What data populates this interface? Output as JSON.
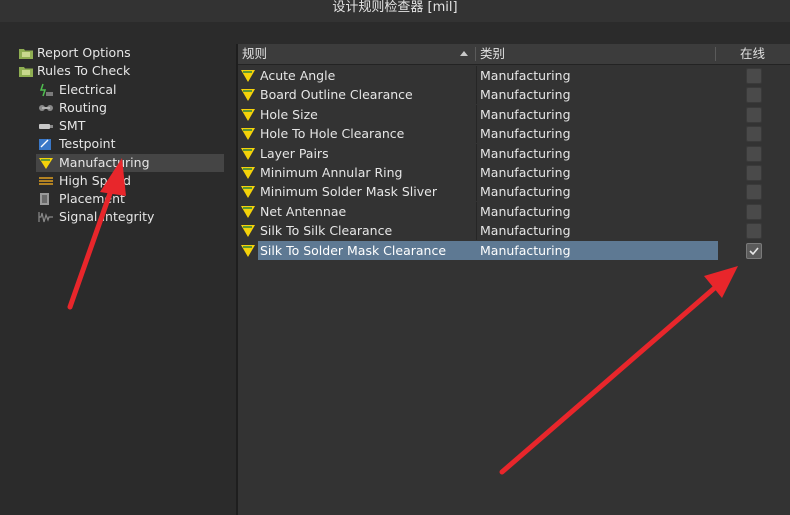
{
  "window": {
    "title": "设计规则检查器 [mil]"
  },
  "tree": {
    "items": [
      {
        "label": "Report Options",
        "icon": "report-folder-icon",
        "level": 0
      },
      {
        "label": "Rules To Check",
        "icon": "rules-folder-icon",
        "level": 0
      },
      {
        "label": "Electrical",
        "icon": "electrical-icon",
        "level": 1
      },
      {
        "label": "Routing",
        "icon": "routing-icon",
        "level": 1
      },
      {
        "label": "SMT",
        "icon": "smt-icon",
        "level": 1
      },
      {
        "label": "Testpoint",
        "icon": "testpoint-icon",
        "level": 1
      },
      {
        "label": "Manufacturing",
        "icon": "manufacturing-icon",
        "level": 1,
        "selected": true
      },
      {
        "label": "High Speed",
        "icon": "high-speed-icon",
        "level": 1
      },
      {
        "label": "Placement",
        "icon": "placement-icon",
        "level": 1
      },
      {
        "label": "Signal Integrity",
        "icon": "signal-integrity-icon",
        "level": 1
      }
    ]
  },
  "grid": {
    "columns": {
      "rule": "规则",
      "category": "类别",
      "online": "在线"
    },
    "rows": [
      {
        "rule": "Acute Angle",
        "category": "Manufacturing",
        "online": false
      },
      {
        "rule": "Board Outline Clearance",
        "category": "Manufacturing",
        "online": false
      },
      {
        "rule": "Hole Size",
        "category": "Manufacturing",
        "online": false
      },
      {
        "rule": "Hole To Hole Clearance",
        "category": "Manufacturing",
        "online": false
      },
      {
        "rule": "Layer Pairs",
        "category": "Manufacturing",
        "online": false
      },
      {
        "rule": "Minimum Annular Ring",
        "category": "Manufacturing",
        "online": false
      },
      {
        "rule": "Minimum Solder Mask Sliver",
        "category": "Manufacturing",
        "online": false
      },
      {
        "rule": "Net Antennae",
        "category": "Manufacturing",
        "online": false
      },
      {
        "rule": "Silk To Silk Clearance",
        "category": "Manufacturing",
        "online": false
      },
      {
        "rule": "Silk To Solder Mask Clearance",
        "category": "Manufacturing",
        "online": true,
        "selected": true
      }
    ]
  },
  "colors": {
    "annotation_arrow": "#e8262b",
    "selection": "#5e7993",
    "rule_icon": "#f4d20a"
  }
}
